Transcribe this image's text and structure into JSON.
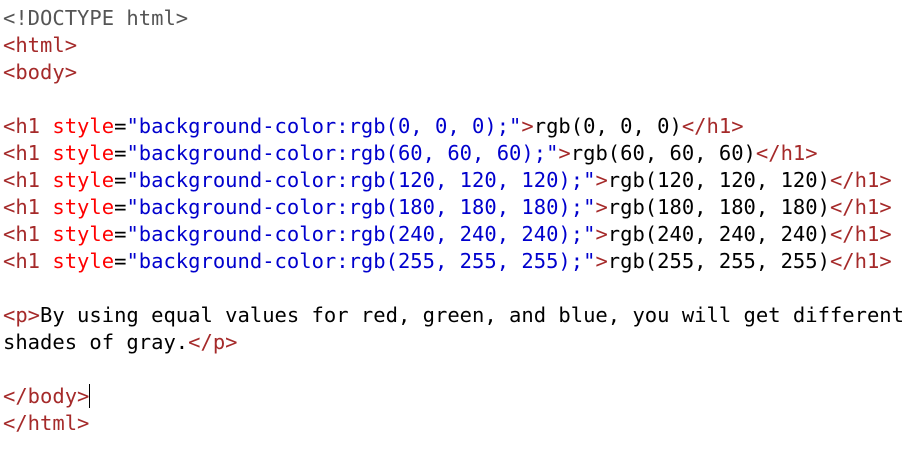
{
  "colors": {
    "tag": "#a52a2a",
    "attribute": "#ff0000",
    "value": "#0000cd",
    "text": "#000000",
    "doctype": "#555555",
    "background": "#ffffff"
  },
  "lines": [
    [
      {
        "t": "doctype",
        "v": "<!DOCTYPE html>"
      }
    ],
    [
      {
        "t": "tag",
        "v": "<html>"
      }
    ],
    [
      {
        "t": "tag",
        "v": "<body>"
      }
    ],
    [],
    [
      {
        "t": "tag",
        "v": "<h1 "
      },
      {
        "t": "attr",
        "v": "style"
      },
      {
        "t": "text",
        "v": "="
      },
      {
        "t": "val",
        "v": "\"background-color:rgb(0, 0, 0);\""
      },
      {
        "t": "tag",
        "v": ">"
      },
      {
        "t": "text",
        "v": "rgb(0, 0, 0)"
      },
      {
        "t": "tag",
        "v": "</h1>"
      }
    ],
    [
      {
        "t": "tag",
        "v": "<h1 "
      },
      {
        "t": "attr",
        "v": "style"
      },
      {
        "t": "text",
        "v": "="
      },
      {
        "t": "val",
        "v": "\"background-color:rgb(60, 60, 60);\""
      },
      {
        "t": "tag",
        "v": ">"
      },
      {
        "t": "text",
        "v": "rgb(60, 60, 60)"
      },
      {
        "t": "tag",
        "v": "</h1>"
      }
    ],
    [
      {
        "t": "tag",
        "v": "<h1 "
      },
      {
        "t": "attr",
        "v": "style"
      },
      {
        "t": "text",
        "v": "="
      },
      {
        "t": "val",
        "v": "\"background-color:rgb(120, 120, 120);\""
      },
      {
        "t": "tag",
        "v": ">"
      },
      {
        "t": "text",
        "v": "rgb(120, 120, 120)"
      },
      {
        "t": "tag",
        "v": "</h1>"
      }
    ],
    [
      {
        "t": "tag",
        "v": "<h1 "
      },
      {
        "t": "attr",
        "v": "style"
      },
      {
        "t": "text",
        "v": "="
      },
      {
        "t": "val",
        "v": "\"background-color:rgb(180, 180, 180);\""
      },
      {
        "t": "tag",
        "v": ">"
      },
      {
        "t": "text",
        "v": "rgb(180, 180, 180)"
      },
      {
        "t": "tag",
        "v": "</h1>"
      }
    ],
    [
      {
        "t": "tag",
        "v": "<h1 "
      },
      {
        "t": "attr",
        "v": "style"
      },
      {
        "t": "text",
        "v": "="
      },
      {
        "t": "val",
        "v": "\"background-color:rgb(240, 240, 240);\""
      },
      {
        "t": "tag",
        "v": ">"
      },
      {
        "t": "text",
        "v": "rgb(240, 240, 240)"
      },
      {
        "t": "tag",
        "v": "</h1>"
      }
    ],
    [
      {
        "t": "tag",
        "v": "<h1 "
      },
      {
        "t": "attr",
        "v": "style"
      },
      {
        "t": "text",
        "v": "="
      },
      {
        "t": "val",
        "v": "\"background-color:rgb(255, 255, 255);\""
      },
      {
        "t": "tag",
        "v": ">"
      },
      {
        "t": "text",
        "v": "rgb(255, 255, 255)"
      },
      {
        "t": "tag",
        "v": "</h1>"
      }
    ],
    [],
    [
      {
        "t": "tag",
        "v": "<p>"
      },
      {
        "t": "text",
        "v": "By using equal values for red, green, and blue, you will get different"
      }
    ],
    [
      {
        "t": "text",
        "v": "shades of gray."
      },
      {
        "t": "tag",
        "v": "</p>"
      }
    ],
    [],
    [
      {
        "t": "tag",
        "v": "</body>"
      }
    ],
    [
      {
        "t": "tag",
        "v": "</html>"
      }
    ]
  ],
  "caret_line": 14
}
